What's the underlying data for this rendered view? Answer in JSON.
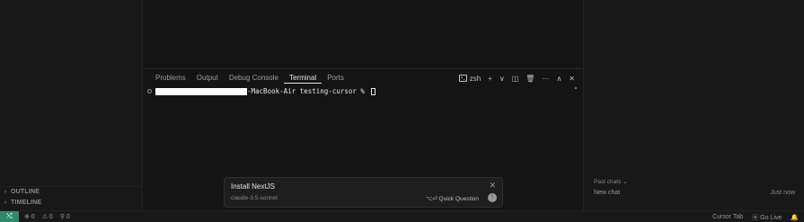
{
  "sidebar": {
    "sections": [
      {
        "label": "OUTLINE"
      },
      {
        "label": "TIMELINE"
      }
    ]
  },
  "panel": {
    "tabs": [
      "Problems",
      "Output",
      "Debug Console",
      "Terminal",
      "Ports"
    ],
    "active_tab": "Terminal",
    "shell_name": "zsh",
    "actions": {
      "add": "+",
      "dropdown": "∨",
      "split": "◫",
      "trash": "🗑",
      "more": "···",
      "maximize": "∧",
      "close": "✕"
    }
  },
  "terminal": {
    "prompt": "-MacBook-Air testing-cursor % "
  },
  "popup": {
    "title": "Install NextJS",
    "model": "claude-3.5-sonnet",
    "quick_question": "⌥⏎ Quick Question",
    "close": "✕",
    "send": "↑"
  },
  "chat": {
    "past_chats": "Past chats ⌄",
    "new_chat": "New chat",
    "time": "Just now"
  },
  "statusbar": {
    "remote_icon": "⤭",
    "errors": "⊗ 0",
    "warnings": "⚠ 0",
    "ports": "⚲ 0",
    "cursor_tab": "Cursor Tab",
    "go_live": "⦿ Go Live",
    "bell": "🔔"
  },
  "colors": {
    "background": "#141414",
    "accent": "#2f8a6a"
  }
}
